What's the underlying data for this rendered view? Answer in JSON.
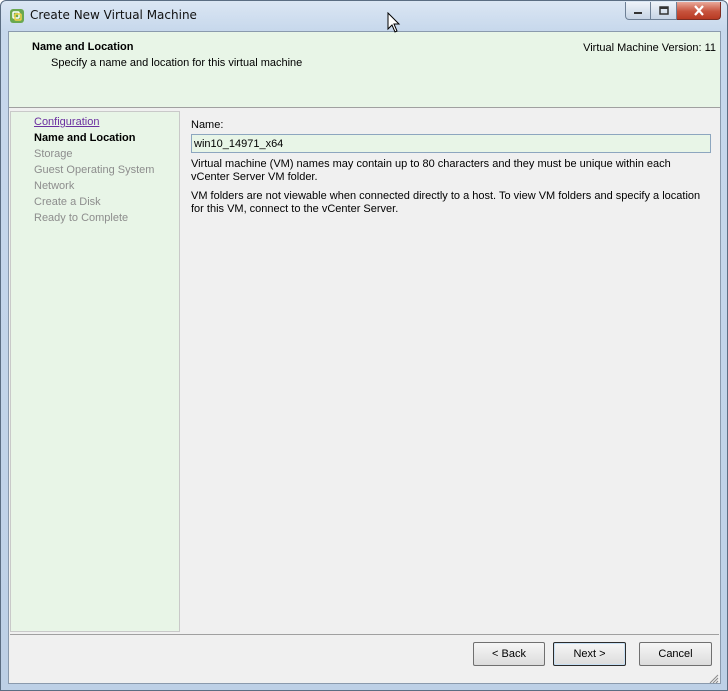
{
  "window": {
    "title": "Create New Virtual Machine",
    "app_icon": "vsphere-logo-icon",
    "minimize_icon": "minimize-icon",
    "maximize_icon": "maximize-icon",
    "close_icon": "close-icon"
  },
  "header": {
    "title": "Name and Location",
    "subtitle": "Specify a name and location for this virtual machine",
    "version": "Virtual Machine Version: 11"
  },
  "steps": [
    {
      "label": "Configuration",
      "state": "link"
    },
    {
      "label": "Name and Location",
      "state": "current"
    },
    {
      "label": "Storage",
      "state": "disabled"
    },
    {
      "label": "Guest Operating System",
      "state": "disabled"
    },
    {
      "label": "Network",
      "state": "disabled"
    },
    {
      "label": "Create a Disk",
      "state": "disabled"
    },
    {
      "label": "Ready to Complete",
      "state": "disabled"
    }
  ],
  "form": {
    "name_label": "Name:",
    "name_value": "win10_14971_x64",
    "help_text_1": "Virtual machine (VM) names may contain up to 80 characters and they must be unique within each vCenter Server VM folder.",
    "help_text_2": "VM folders are not viewable when connected directly to a host. To view VM folders and specify a location for this VM, connect to the vCenter Server."
  },
  "buttons": {
    "back": "< Back",
    "next": "Next >",
    "cancel": "Cancel"
  },
  "colors": {
    "panel_green": "#e8f5e7",
    "link_purple": "#6b2fa0",
    "disabled_gray": "#8d8d8d"
  }
}
